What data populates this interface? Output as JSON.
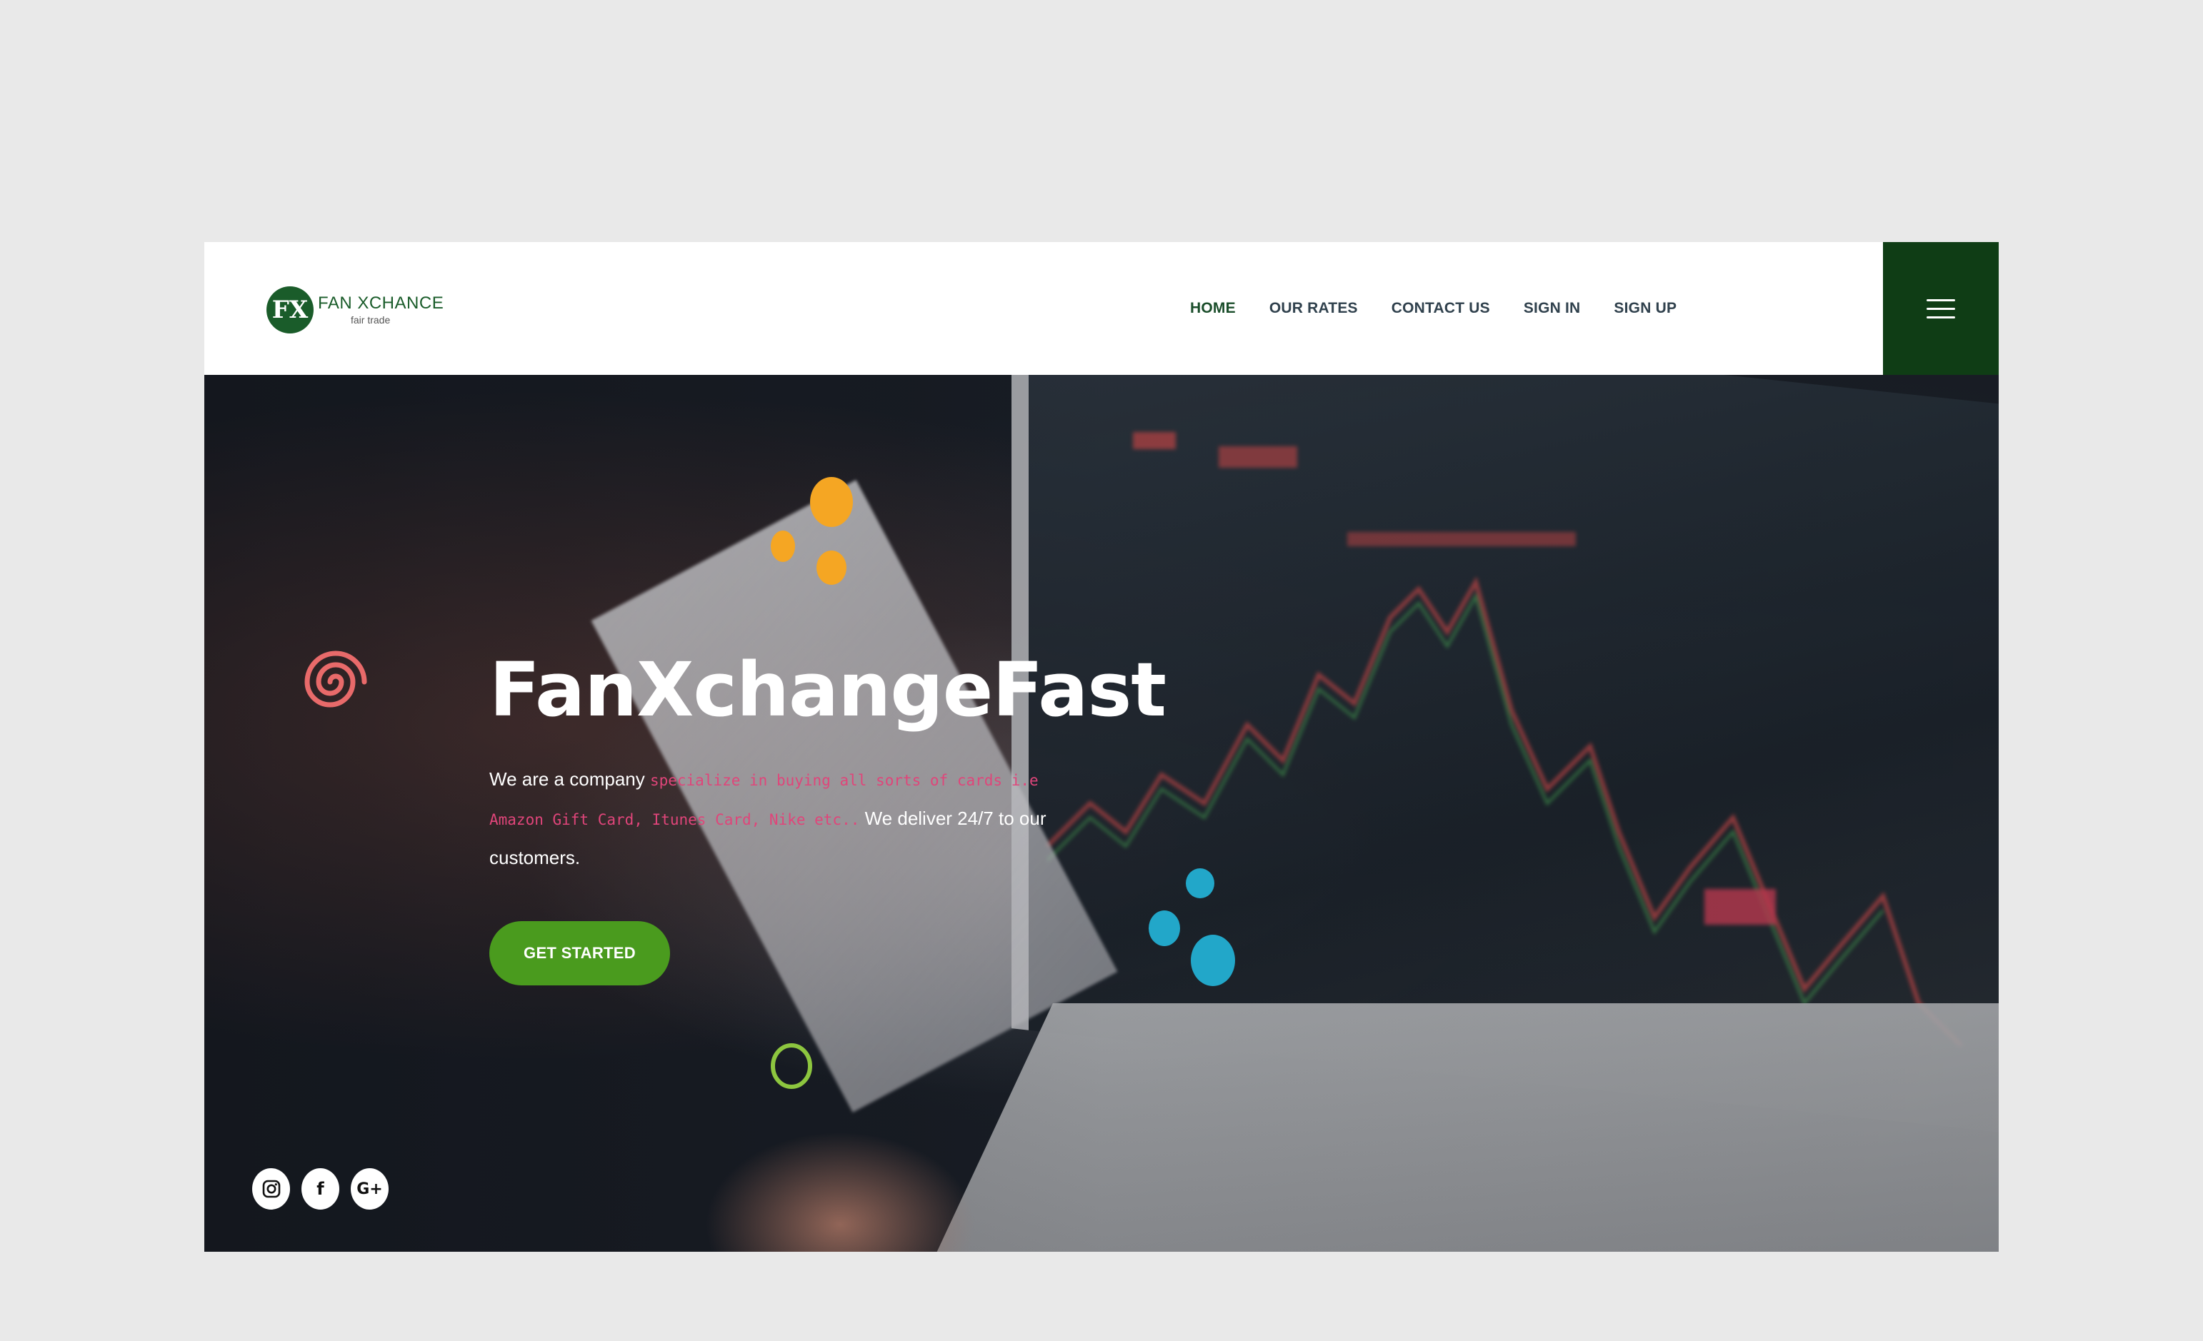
{
  "brand": {
    "logo_letters": "FX",
    "name": "FAN XCHANCE",
    "tagline": "fair trade",
    "color": "#1a5c2a"
  },
  "nav": {
    "items": [
      {
        "label": "HOME",
        "active": true
      },
      {
        "label": "OUR RATES",
        "active": false
      },
      {
        "label": "CONTACT US",
        "active": false
      },
      {
        "label": "SIGN IN",
        "active": false
      },
      {
        "label": "SIGN UP",
        "active": false
      }
    ],
    "menu_icon": "hamburger-icon",
    "menu_bg": "#0f3d15"
  },
  "hero": {
    "title": "FanXchangeFast",
    "text_before": "We are a company ",
    "text_highlight": "specialize in buying all sorts of cards i.e Amazon Gift Card, Itunes Card, Nike etc..",
    "text_after": " We deliver 24/7 to our customers.",
    "cta_label": "GET STARTED",
    "cta_color": "#4a9b1e",
    "highlight_color": "#e0457a"
  },
  "social": {
    "icons": [
      "instagram-icon",
      "facebook-icon",
      "google-plus-icon"
    ],
    "facebook_glyph": "f",
    "google_glyph": "G+"
  }
}
